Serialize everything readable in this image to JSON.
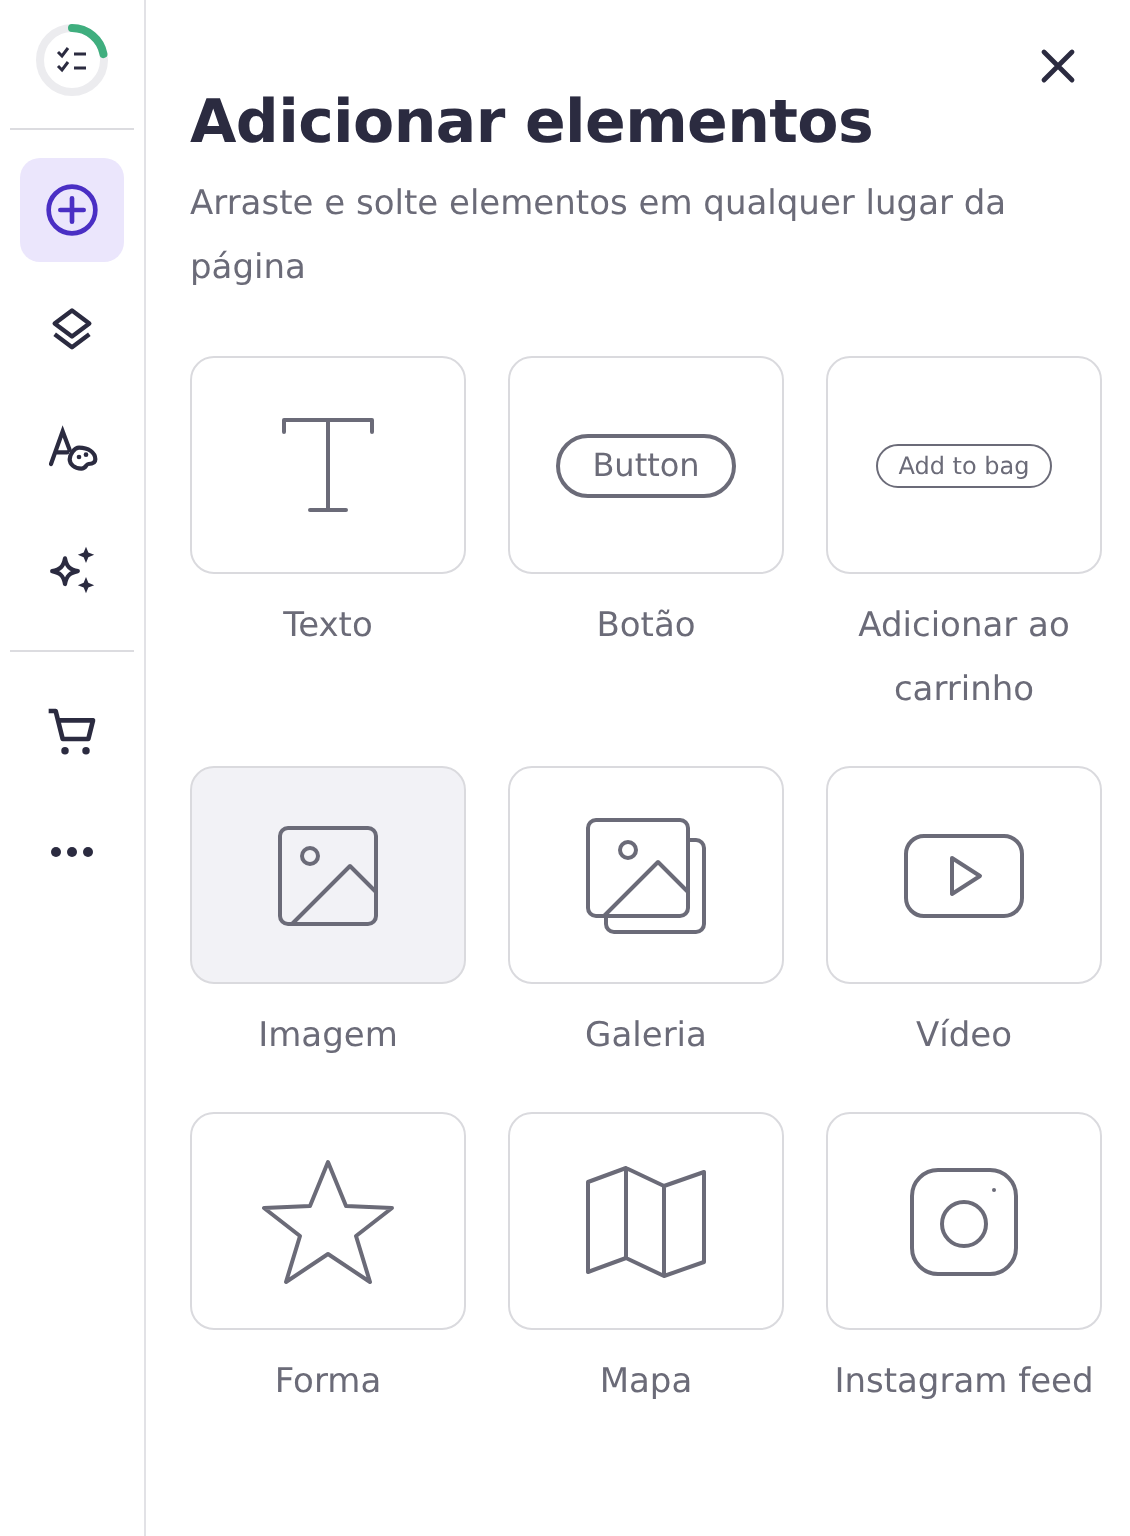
{
  "sidebar": {
    "groups": [
      {
        "items": [
          {
            "kind": "add",
            "selected": true
          },
          {
            "kind": "layers",
            "selected": false
          },
          {
            "kind": "styles",
            "selected": false
          },
          {
            "kind": "ai",
            "selected": false
          }
        ]
      },
      {
        "items": [
          {
            "kind": "cart",
            "selected": false
          },
          {
            "kind": "more",
            "selected": false
          }
        ]
      }
    ]
  },
  "panel": {
    "title": "Adicionar elementos",
    "subtitle": "Arraste e solte elementos em qualquer lugar da página",
    "rows": [
      {
        "elements": [
          {
            "kind": "text",
            "label": "Texto",
            "highlighted": false
          },
          {
            "kind": "button",
            "label": "Botão",
            "preview": {
              "text": "Button"
            },
            "highlighted": false
          },
          {
            "kind": "addtobag",
            "label": "Adicionar ao carrinho",
            "preview": {
              "text": "Add to bag"
            },
            "highlighted": false
          }
        ]
      },
      {
        "elements": [
          {
            "kind": "image",
            "label": "Imagem",
            "highlighted": true
          },
          {
            "kind": "gallery",
            "label": "Galeria",
            "highlighted": false
          },
          {
            "kind": "video",
            "label": "Vídeo",
            "highlighted": false
          }
        ]
      },
      {
        "elements": [
          {
            "kind": "shape",
            "label": "Forma",
            "highlighted": false
          },
          {
            "kind": "map",
            "label": "Mapa",
            "highlighted": false
          },
          {
            "kind": "instagram",
            "label": "Instagram feed",
            "highlighted": false
          }
        ]
      }
    ]
  }
}
